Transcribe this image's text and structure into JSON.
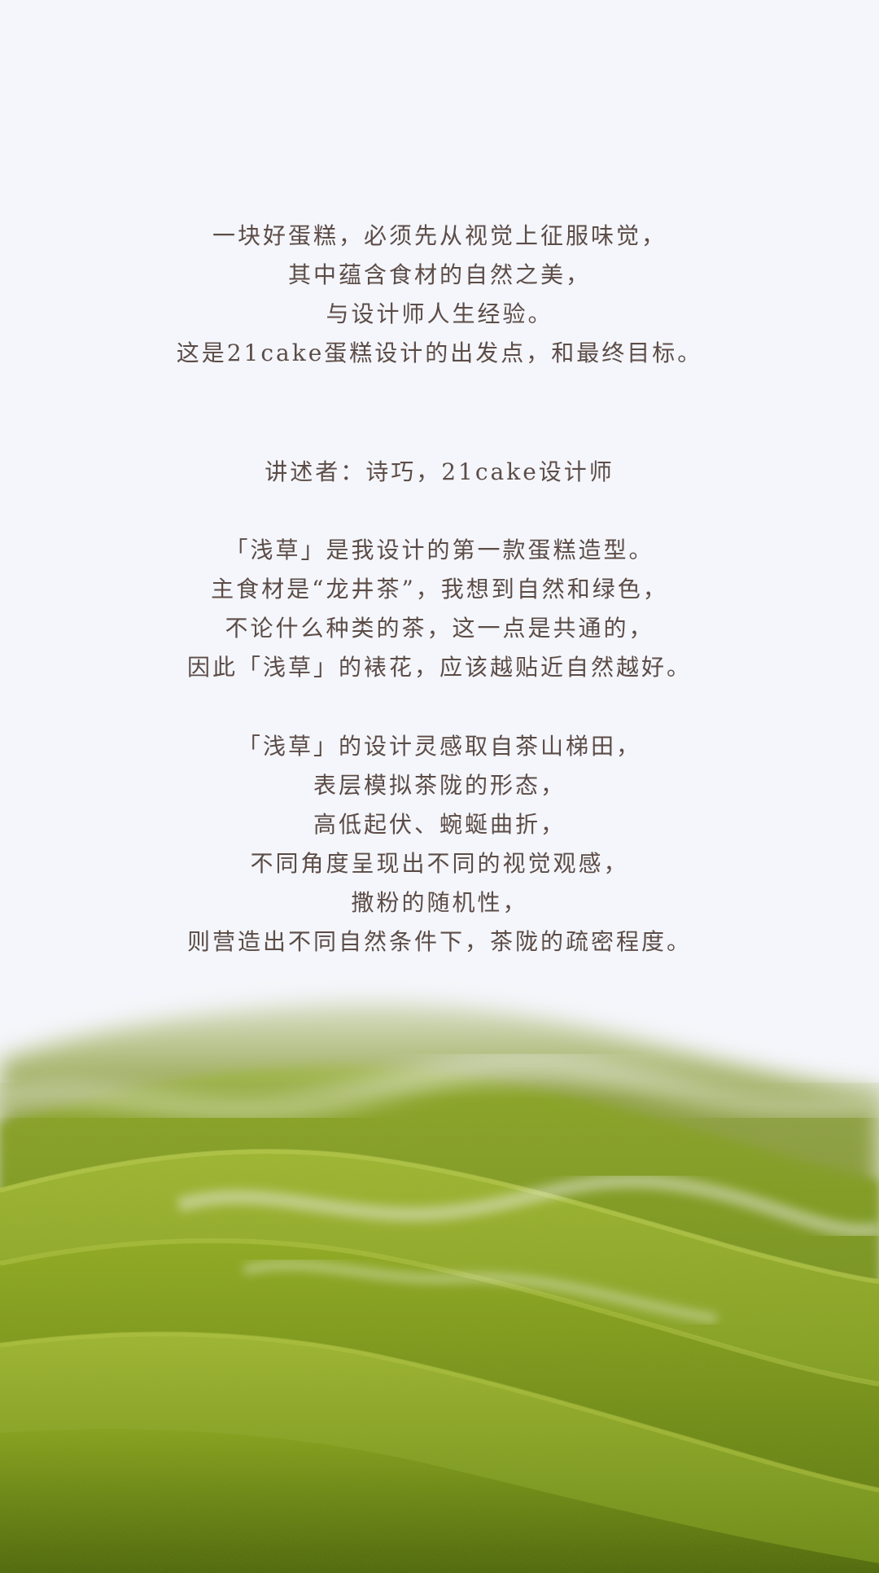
{
  "intro": {
    "lines": [
      "一块好蛋糕，必须先从视觉上征服味觉，",
      "其中蕴含食材的自然之美，",
      "与设计师人生经验。",
      "这是21cake蛋糕设计的出发点，和最终目标。"
    ]
  },
  "narrator": "讲述者：诗巧，21cake设计师",
  "paragraph1": {
    "lines": [
      "「浅草」是我设计的第一款蛋糕造型。",
      "主食材是“龙井茶”，我想到自然和绿色，",
      "不论什么种类的茶，这一点是共通的，",
      "因此「浅草」的裱花，应该越贴近自然越好。"
    ]
  },
  "paragraph2": {
    "lines": [
      "「浅草」的设计灵感取自茶山梯田，",
      "表层模拟茶陇的形态，",
      "高低起伏、蜿蜒曲折，",
      "不同角度呈现出不同的视觉观感，",
      "撒粉的随机性，",
      "则营造出不同自然条件下，茶陇的疏密程度。"
    ]
  },
  "image": {
    "subject": "matcha-tea-terrace-cake-surface",
    "colors": {
      "background": "#f4f6fb",
      "deep_green": "#4f6b12",
      "mid_green": "#7f9a1e",
      "light_green": "#a9bd3c",
      "mist": "#eef0ee",
      "text": "#5c4c47"
    }
  }
}
